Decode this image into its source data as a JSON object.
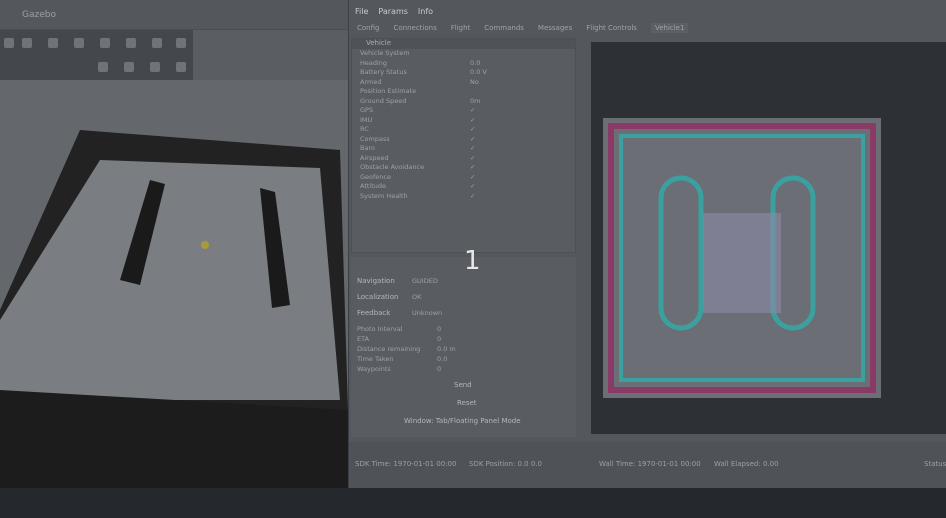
{
  "left_window": {
    "title": "Gazebo"
  },
  "right_window": {
    "menu": [
      "File",
      "Params",
      "Info"
    ],
    "tabs": [
      "Config",
      "Connections",
      "Flight",
      "Commands",
      "Messages",
      "Flight Controls",
      "Vehicle1"
    ],
    "tree_header": "Vehicle",
    "tree": [
      {
        "name": "Vehicle System",
        "value": ""
      },
      {
        "name": "Heading",
        "value": "0.0"
      },
      {
        "name": "Battery Status",
        "value": "0.0 V"
      },
      {
        "name": "Armed",
        "value": "No"
      },
      {
        "name": "Position Estimate",
        "value": ""
      },
      {
        "name": "Ground Speed",
        "value": "0m"
      },
      {
        "name": "GPS",
        "value": "✓"
      },
      {
        "name": "IMU",
        "value": "✓"
      },
      {
        "name": "RC",
        "value": "✓"
      },
      {
        "name": "Compass",
        "value": "✓"
      },
      {
        "name": "Baro",
        "value": "✓"
      },
      {
        "name": "Airspeed",
        "value": "✓"
      },
      {
        "name": "Obstacle Avoidance",
        "value": "✓"
      },
      {
        "name": "Geofence",
        "value": "✓"
      },
      {
        "name": "Attitude",
        "value": "✓"
      },
      {
        "name": "System Health",
        "value": "✓"
      }
    ],
    "info": {
      "navigation_label": "Navigation",
      "navigation_value": "GUIDED",
      "localization_label": "Localization",
      "localization_value": "OK",
      "feedback_label": "Feedback",
      "feedback_value": "Unknown",
      "stats": [
        {
          "k": "Photo Interval",
          "v": "0"
        },
        {
          "k": "ETA",
          "v": "0"
        },
        {
          "k": "Distance remaining",
          "v": "0.0 m"
        },
        {
          "k": "Time Taken",
          "v": "0.0"
        },
        {
          "k": "Waypoints",
          "v": "0"
        }
      ],
      "btn1": "Send",
      "btn2": "Reset",
      "window_mode": "Window: Tab/Floating Panel Mode"
    },
    "status": {
      "header": "Status",
      "items": [
        "SDK Time: 1970-01-01 00:00",
        "SDK Position: 0.0 0.0",
        "Wall Time: 1970-01-01 00:00",
        "Wall Elapsed: 0.00"
      ],
      "right": "Status"
    }
  },
  "overlay_label": "1"
}
